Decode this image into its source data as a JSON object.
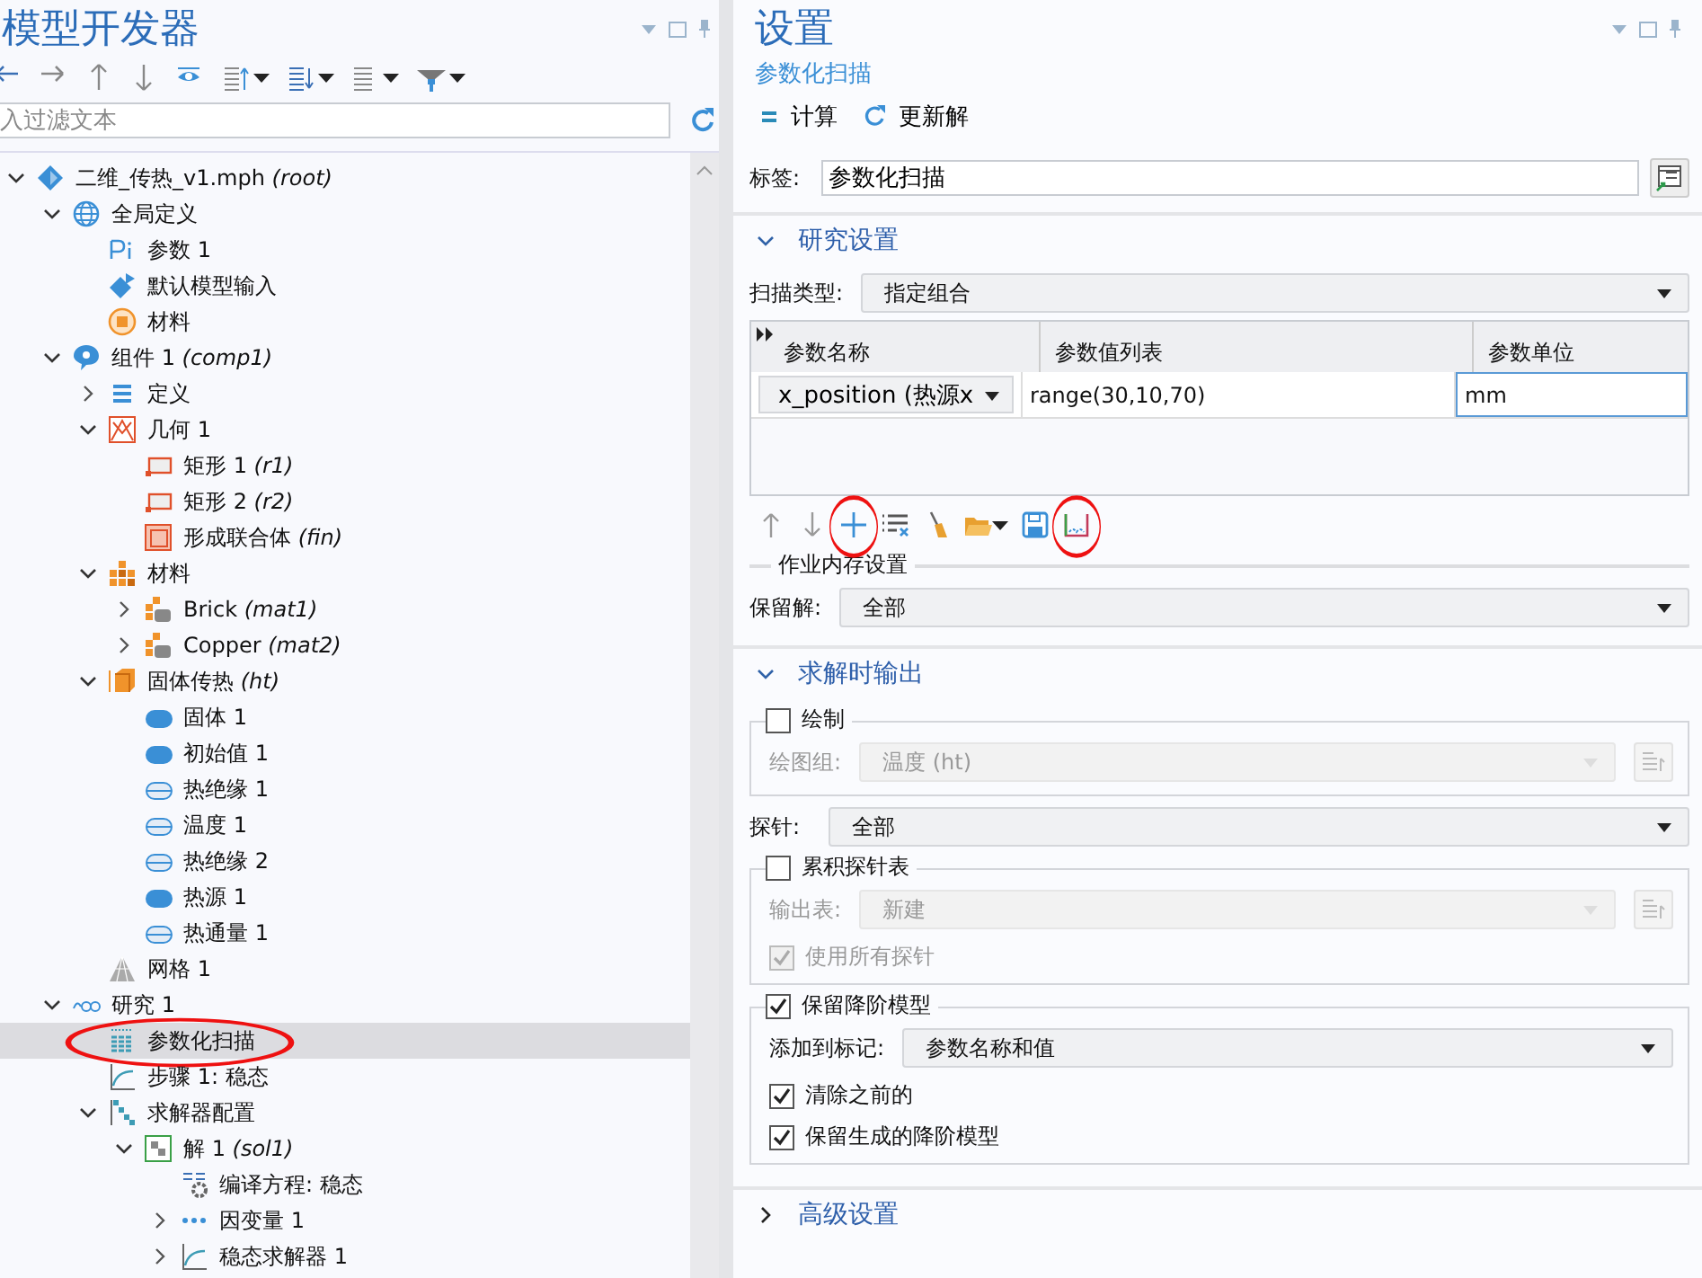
{
  "tree_panel": {
    "title": "模型开发器",
    "filter": {
      "placeholder": "入过滤文本"
    },
    "tree": [
      {
        "label": "二维_传热_v1.mph *(root)*",
        "kind": "model",
        "expanded": true,
        "selected": false,
        "annotated": false,
        "children": [
          {
            "label": "全局定义",
            "kind": "globe",
            "expanded": true,
            "selected": false,
            "annotated": false,
            "children": [
              {
                "label": "参数 1",
                "kind": "param",
                "selected": false,
                "annotated": false
              },
              {
                "label": "默认模型输入",
                "kind": "input",
                "selected": false,
                "annotated": false
              },
              {
                "label": "材料",
                "kind": "ball",
                "selected": false,
                "annotated": false
              }
            ]
          },
          {
            "label": "组件 1 *(comp1)*",
            "kind": "component",
            "expanded": true,
            "selected": false,
            "annotated": false,
            "children": [
              {
                "label": "定义",
                "kind": "list",
                "expanded": false,
                "selected": false,
                "annotated": false
              },
              {
                "label": "几何 1",
                "kind": "geometry",
                "expanded": true,
                "selected": false,
                "annotated": false,
                "children": [
                  {
                    "label": "矩形 1 *(r1)*",
                    "kind": "rect",
                    "selected": false,
                    "annotated": false
                  },
                  {
                    "label": "矩形 2 *(r2)*",
                    "kind": "rect",
                    "selected": false,
                    "annotated": false
                  },
                  {
                    "label": "形成联合体 *(fin)*",
                    "kind": "union",
                    "selected": false,
                    "annotated": false
                  }
                ]
              },
              {
                "label": "材料",
                "kind": "materials",
                "expanded": true,
                "selected": false,
                "annotated": false,
                "children": [
                  {
                    "label": "Brick *(mat1)*",
                    "kind": "material",
                    "expanded": false,
                    "selected": false,
                    "annotated": false
                  },
                  {
                    "label": "Copper *(mat2)*",
                    "kind": "material",
                    "expanded": false,
                    "selected": false,
                    "annotated": false
                  }
                ]
              },
              {
                "label": "固体传热 *(ht)*",
                "kind": "physics",
                "expanded": true,
                "selected": false,
                "annotated": false,
                "children": [
                  {
                    "label": "固体 1",
                    "kind": "domain",
                    "selected": false,
                    "annotated": false
                  },
                  {
                    "label": "初始值 1",
                    "kind": "domain",
                    "selected": false,
                    "annotated": false
                  },
                  {
                    "label": "热绝缘 1",
                    "kind": "boundary",
                    "selected": false,
                    "annotated": false
                  },
                  {
                    "label": "温度 1",
                    "kind": "boundary",
                    "selected": false,
                    "annotated": false
                  },
                  {
                    "label": "热绝缘 2",
                    "kind": "boundary",
                    "selected": false,
                    "annotated": false
                  },
                  {
                    "label": "热源 1",
                    "kind": "domain",
                    "selected": false,
                    "annotated": false
                  },
                  {
                    "label": "热通量 1",
                    "kind": "boundary",
                    "selected": false,
                    "annotated": false
                  }
                ]
              },
              {
                "label": "网格 1",
                "kind": "mesh",
                "selected": false,
                "annotated": false
              }
            ]
          },
          {
            "label": "研究 1",
            "kind": "study",
            "expanded": true,
            "selected": false,
            "annotated": false,
            "children": [
              {
                "label": "参数化扫描",
                "kind": "sweep",
                "selected": true,
                "annotated": true
              },
              {
                "label": "步骤 1: 稳态",
                "kind": "step",
                "selected": false,
                "annotated": false
              },
              {
                "label": "求解器配置",
                "kind": "solver",
                "expanded": true,
                "selected": false,
                "annotated": false,
                "children": [
                  {
                    "label": "解 1 *(sol1)*",
                    "kind": "solution",
                    "expanded": true,
                    "selected": false,
                    "annotated": false,
                    "children": [
                      {
                        "label": "编译方程: 稳态",
                        "kind": "compile",
                        "selected": false,
                        "annotated": false
                      },
                      {
                        "label": "因变量 1",
                        "kind": "depvar",
                        "expanded": false,
                        "selected": false,
                        "annotated": false
                      },
                      {
                        "label": "稳态求解器 1",
                        "kind": "step",
                        "expanded": false,
                        "selected": false,
                        "annotated": false
                      }
                    ]
                  }
                ]
              }
            ]
          }
        ]
      }
    ]
  },
  "settings": {
    "title": "设置",
    "subtitle": "参数化扫描",
    "actions": [
      {
        "label": "计算",
        "kind": "equals"
      },
      {
        "label": "更新解",
        "kind": "refresh"
      }
    ],
    "label_field": {
      "label": "标签:",
      "value": "参数化扫描"
    },
    "sections": [
      {
        "title": "研究设置",
        "expanded": true,
        "items": [
          {
            "kind": "select",
            "label": "扫描类型:",
            "value": "指定组合",
            "disabled": false,
            "side_button": false
          },
          {
            "kind": "table",
            "columns": [
              "参数名称",
              "参数值列表",
              "参数单位"
            ],
            "rows": [
              [
                {
                  "kind": "select",
                  "value": "x_position (热源x",
                  "focused": false
                },
                {
                  "kind": "text",
                  "value": "range(30,10,70)",
                  "focused": false
                },
                {
                  "kind": "text",
                  "value": "mm",
                  "focused": true
                }
              ]
            ],
            "tools": [
              {
                "kind": "up",
                "annotated": false,
                "menu": false
              },
              {
                "kind": "down",
                "annotated": false,
                "menu": false
              },
              {
                "kind": "plus",
                "annotated": true,
                "menu": false
              },
              {
                "kind": "clear",
                "annotated": false,
                "menu": false
              },
              {
                "kind": "broom",
                "annotated": false,
                "menu": false
              },
              {
                "kind": "folder",
                "annotated": false,
                "menu": true
              },
              {
                "kind": "save",
                "annotated": false,
                "menu": false
              },
              {
                "kind": "chart",
                "annotated": true,
                "menu": false
              }
            ]
          },
          {
            "kind": "heading",
            "title": "作业内存设置"
          },
          {
            "kind": "select",
            "label": "保留解:",
            "value": "全部",
            "disabled": false,
            "side_button": false
          }
        ]
      },
      {
        "title": "求解时输出",
        "expanded": true,
        "items": [
          {
            "kind": "group",
            "title": "绘制",
            "checked": false,
            "items": [
              {
                "kind": "select",
                "label": "绘图组:",
                "value": "温度 (ht)",
                "disabled": true,
                "side_button": true
              }
            ]
          },
          {
            "kind": "select",
            "label": "探针:",
            "value": "全部",
            "disabled": false,
            "side_button": false
          },
          {
            "kind": "group",
            "title": "累积探针表",
            "checked": false,
            "items": [
              {
                "kind": "select",
                "label": "输出表:",
                "value": "新建",
                "disabled": true,
                "side_button": true
              },
              {
                "kind": "checkbox",
                "label": "使用所有探针",
                "checked": true,
                "disabled": true
              }
            ]
          },
          {
            "kind": "group",
            "title": "保留降阶模型",
            "checked": true,
            "items": [
              {
                "kind": "select",
                "label": "添加到标记:",
                "value": "参数名称和值",
                "disabled": false,
                "side_button": false
              },
              {
                "kind": "checkbox",
                "label": "清除之前的",
                "checked": true,
                "disabled": false
              },
              {
                "kind": "checkbox",
                "label": "保留生成的降阶模型",
                "checked": true,
                "disabled": false
              }
            ]
          }
        ]
      },
      {
        "title": "高级设置",
        "expanded": false
      }
    ]
  }
}
